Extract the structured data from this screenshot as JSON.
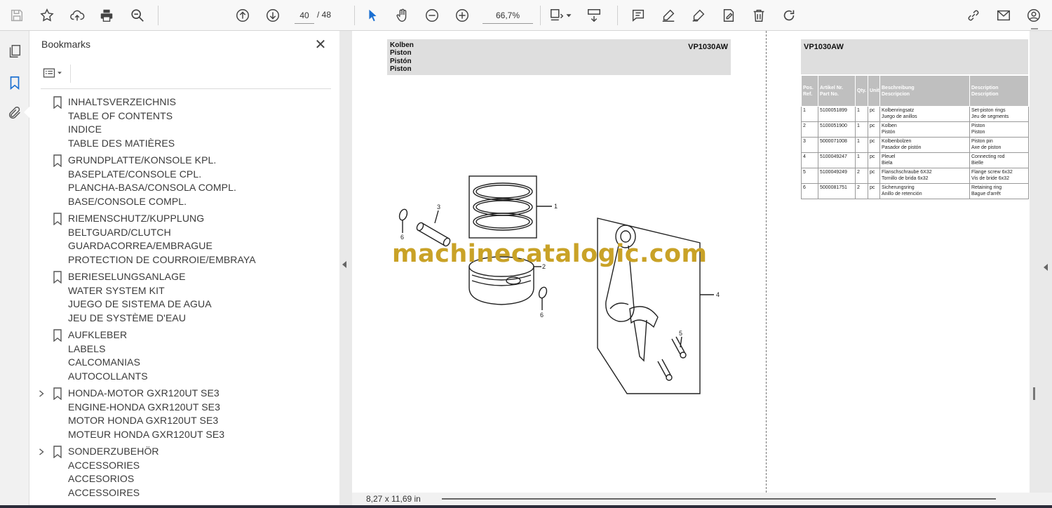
{
  "toolbar": {
    "page_current": "40",
    "page_total": "/ 48",
    "zoom": "66,7%"
  },
  "bookmarks": {
    "title": "Bookmarks",
    "groups": [
      {
        "lines": [
          "INHALTSVERZEICHNIS",
          "TABLE OF CONTENTS",
          "INDICE",
          "TABLE DES MATIÈRES"
        ],
        "expandable": false
      },
      {
        "lines": [
          "GRUNDPLATTE/KONSOLE KPL.",
          "BASEPLATE/CONSOLE CPL.",
          "PLANCHA-BASA/CONSOLA COMPL.",
          "BASE/CONSOLE COMPL."
        ],
        "expandable": false
      },
      {
        "lines": [
          "RIEMENSCHUTZ/KUPPLUNG",
          "BELTGUARD/CLUTCH",
          "GUARDACORREA/EMBRAGUE",
          "PROTECTION DE COURROIE/EMBRAYA"
        ],
        "expandable": false
      },
      {
        "lines": [
          "BERIESELUNGSANLAGE",
          "WATER SYSTEM KIT",
          "JUEGO DE SISTEMA DE AGUA",
          "JEU DE SYSTÈME D'EAU"
        ],
        "expandable": false
      },
      {
        "lines": [
          "AUFKLEBER",
          "LABELS",
          "CALCOMANIAS",
          "AUTOCOLLANTS"
        ],
        "expandable": false
      },
      {
        "lines": [
          "HONDA-MOTOR GXR120UT SE3",
          "ENGINE-HONDA GXR120UT SE3",
          "MOTOR HONDA GXR120UT SE3",
          "MOTEUR HONDA GXR120UT SE3"
        ],
        "expandable": true
      },
      {
        "lines": [
          "SONDERZUBEHÖR",
          "ACCESSORIES",
          "ACCESORIOS",
          "ACCESSOIRES"
        ],
        "expandable": true
      }
    ]
  },
  "page": {
    "header_lines": [
      "Kolben",
      "Piston",
      "Pistón",
      "Piston"
    ],
    "model": "VP1030AW",
    "model_right": "VP1030AW",
    "watermark": "machinecatalogic.com",
    "callouts": [
      "1",
      "2",
      "3",
      "4",
      "5",
      "6",
      "6"
    ],
    "table_headers": [
      "Pos.\nRef.",
      "Artikel Nr.\nPart No.",
      "Qty.",
      "Unit",
      "Beschreibung\nDescripcion",
      "Description\nDescription"
    ],
    "table_rows": [
      [
        "1",
        "5100051899",
        "1",
        "pc",
        "Kolbenringsatz\nJuego de anillos",
        "Set-piston rings\nJeu de segments"
      ],
      [
        "2",
        "5100051900",
        "1",
        "pc",
        "Kolben\nPistón",
        "Piston\nPiston"
      ],
      [
        "3",
        "5000071008",
        "1",
        "pc",
        "Kolbenbolzen\nPasador de pistón",
        "Piston pin\nAxe de piston"
      ],
      [
        "4",
        "5100049247",
        "1",
        "pc",
        "Pleuel\nBiela",
        "Connecting rod\nBielle"
      ],
      [
        "5",
        "5100049249",
        "2",
        "pc",
        "Flanschschraube 6X32\nTornillo de brida 6x32",
        "Flange screw 6x32\nVis de bride 6x32"
      ],
      [
        "6",
        "5000081751",
        "2",
        "pc",
        "Sicherungsring\nAnillo de retención",
        "Retaining ring\nBague d'arrêt"
      ]
    ]
  },
  "status": {
    "page_size": "8,27 x 11,69 in"
  },
  "colors": {
    "watermark": "#c9a227",
    "header_bg": "#dedede",
    "table_header_bg": "#bfbfbf"
  }
}
